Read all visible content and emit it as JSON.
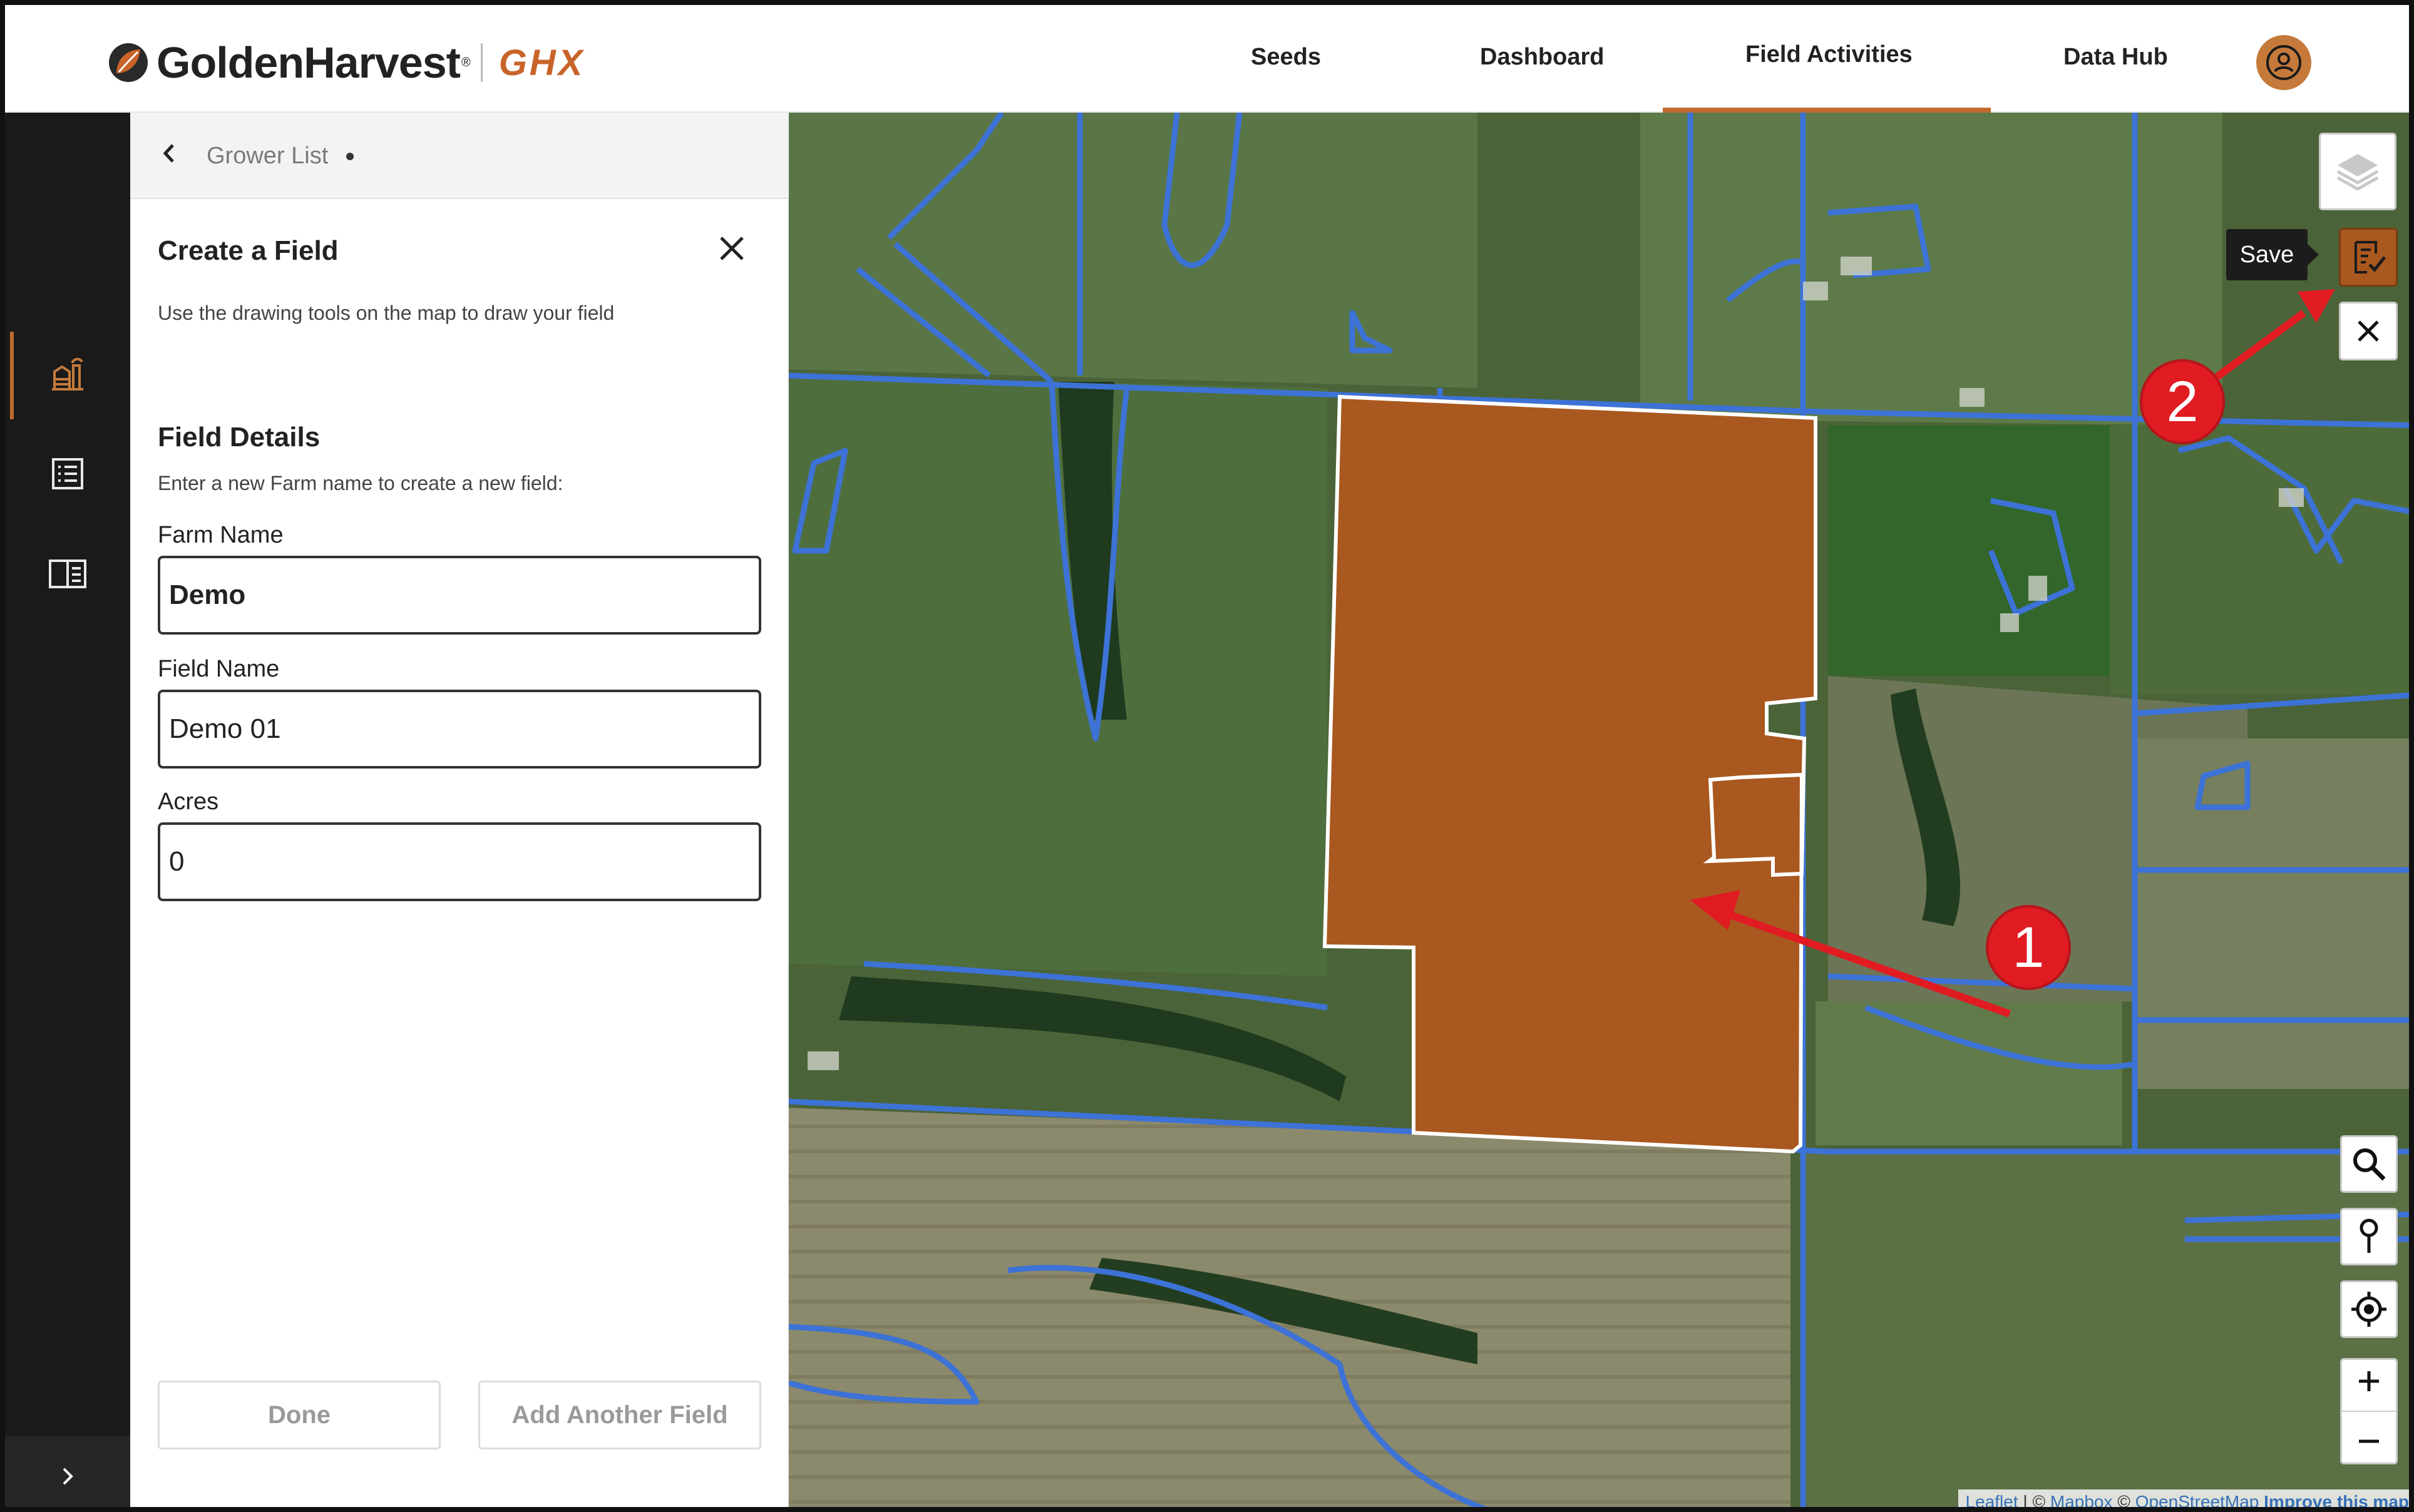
{
  "header": {
    "brand": "GoldenHarvest",
    "brand_mark": "®",
    "product": "GHX",
    "nav": [
      "Seeds",
      "Dashboard",
      "Field Activities",
      "Data Hub"
    ],
    "active_nav": "Field Activities",
    "accent": "#c06a2f"
  },
  "panel": {
    "breadcrumb": "Grower List",
    "title": "Create a Field",
    "instructions": "Use the drawing tools on the map to draw your field",
    "section_title": "Field Details",
    "section_hint": "Enter a new Farm name to create a new field:",
    "farm_name_label": "Farm Name",
    "farm_name_value": "Demo",
    "field_name_label": "Field Name",
    "field_name_value": "Demo 01",
    "acres_label": "Acres",
    "acres_value": "0",
    "done_label": "Done",
    "add_another_label": "Add Another Field"
  },
  "map": {
    "save_tooltip": "Save",
    "field_fill": "#a9581f",
    "boundary_color": "#3d72d6",
    "attribution": {
      "leaflet": "Leaflet",
      "sep1": " | © ",
      "mapbox": "Mapbox",
      "sep2": " © ",
      "osm": "OpenStreetMap",
      "improve": "Improve this map"
    },
    "annotations": [
      "1",
      "2"
    ]
  },
  "rail": {
    "icons": [
      "farm-icon",
      "list-icon",
      "book-icon",
      "chevron-right-icon"
    ]
  }
}
